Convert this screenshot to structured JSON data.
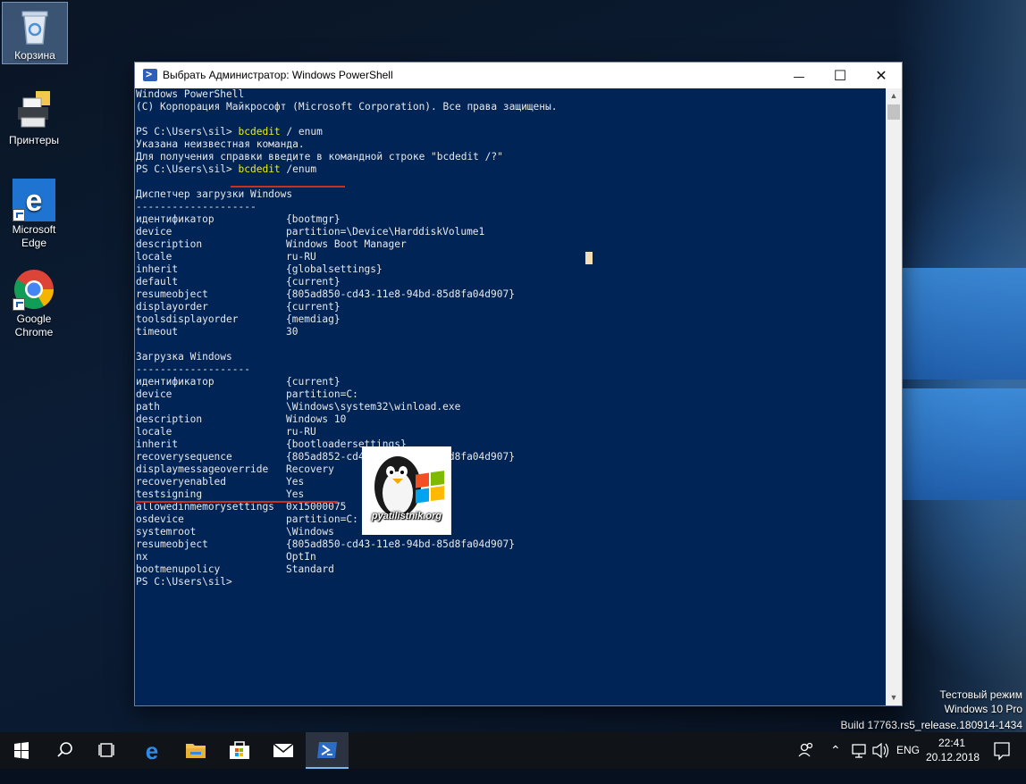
{
  "desktop": {
    "icons": [
      {
        "label": "Корзина",
        "icon": "recycle-bin-icon"
      },
      {
        "label": "Принтеры",
        "icon": "printer-icon"
      },
      {
        "label_lines": [
          "Microsoft",
          "Edge"
        ],
        "icon": "edge-icon"
      },
      {
        "label_lines": [
          "Google",
          "Chrome"
        ],
        "icon": "chrome-icon"
      }
    ],
    "windows_info": {
      "line1": "Тестовый режим",
      "line2": "Windows 10 Pro",
      "line3": "Build 17763.rs5_release.180914-1434"
    }
  },
  "window": {
    "title": "Выбрать Администратор: Windows PowerShell",
    "minimize": "—",
    "maximize": "☐",
    "close": "✕",
    "console_bg": "#012456",
    "prompt": "PS C:\\Users\\sil>",
    "lines": [
      {
        "text": "Windows PowerShell"
      },
      {
        "text": "(C) Корпорация Майкрософт (Microsoft Corporation). Все права защищены."
      },
      {
        "text": ""
      },
      {
        "prompt": "PS C:\\Users\\sil> ",
        "cmd": "bcdedit",
        "rest": " / enum"
      },
      {
        "text": "Указана неизвестная команда."
      },
      {
        "text": "Для получения справки введите в командной строке \"bcdedit /?\""
      },
      {
        "prompt": "PS C:\\Users\\sil> ",
        "cmd": "bcdedit",
        "rest": " /enum"
      },
      {
        "text": ""
      },
      {
        "text": "Диспетчер загрузки Windows"
      },
      {
        "text": "--------------------"
      },
      {
        "key": "идентификатор",
        "val": "{bootmgr}"
      },
      {
        "key": "device",
        "val": "partition=\\Device\\HarddiskVolume1"
      },
      {
        "key": "description",
        "val": "Windows Boot Manager"
      },
      {
        "key": "locale",
        "val": "ru-RU"
      },
      {
        "key": "inherit",
        "val": "{globalsettings}"
      },
      {
        "key": "default",
        "val": "{current}"
      },
      {
        "key": "resumeobject",
        "val": "{805ad850-cd43-11e8-94bd-85d8fa04d907}"
      },
      {
        "key": "displayorder",
        "val": "{current}"
      },
      {
        "key": "toolsdisplayorder",
        "val": "{memdiag}"
      },
      {
        "key": "timeout",
        "val": "30"
      },
      {
        "text": ""
      },
      {
        "text": "Загрузка Windows"
      },
      {
        "text": "-------------------"
      },
      {
        "key": "идентификатор",
        "val": "{current}"
      },
      {
        "key": "device",
        "val": "partition=C:"
      },
      {
        "key": "path",
        "val": "\\Windows\\system32\\winload.exe"
      },
      {
        "key": "description",
        "val": "Windows 10"
      },
      {
        "key": "locale",
        "val": "ru-RU"
      },
      {
        "key": "inherit",
        "val": "{bootloadersettings}"
      },
      {
        "key": "recoverysequence",
        "val": "{805ad852-cd43-11e8-94bd-85d8fa04d907}"
      },
      {
        "key": "displaymessageoverride",
        "val": "Recovery"
      },
      {
        "key": "recoveryenabled",
        "val": "Yes"
      },
      {
        "key": "testsigning",
        "val": "Yes"
      },
      {
        "key": "allowedinmemorysettings",
        "val": "0x15000075"
      },
      {
        "key": "osdevice",
        "val": "partition=C:"
      },
      {
        "key": "systemroot",
        "val": "\\Windows"
      },
      {
        "key": "resumeobject",
        "val": "{805ad850-cd43-11e8-94bd-85d8fa04d907}"
      },
      {
        "key": "nx",
        "val": "OptIn"
      },
      {
        "key": "bootmenupolicy",
        "val": "Standard"
      },
      {
        "text": "PS C:\\Users\\sil>"
      }
    ],
    "watermark_text": "pyatilistnik.org"
  },
  "taskbar": {
    "items": [
      "start-icon",
      "search-icon",
      "task-view-icon",
      "edge-icon",
      "file-explorer-icon",
      "store-icon",
      "mail-icon",
      "powershell-icon"
    ],
    "active": "powershell-icon",
    "lang": "ENG",
    "time": "22:41",
    "date": "20.12.2018"
  }
}
